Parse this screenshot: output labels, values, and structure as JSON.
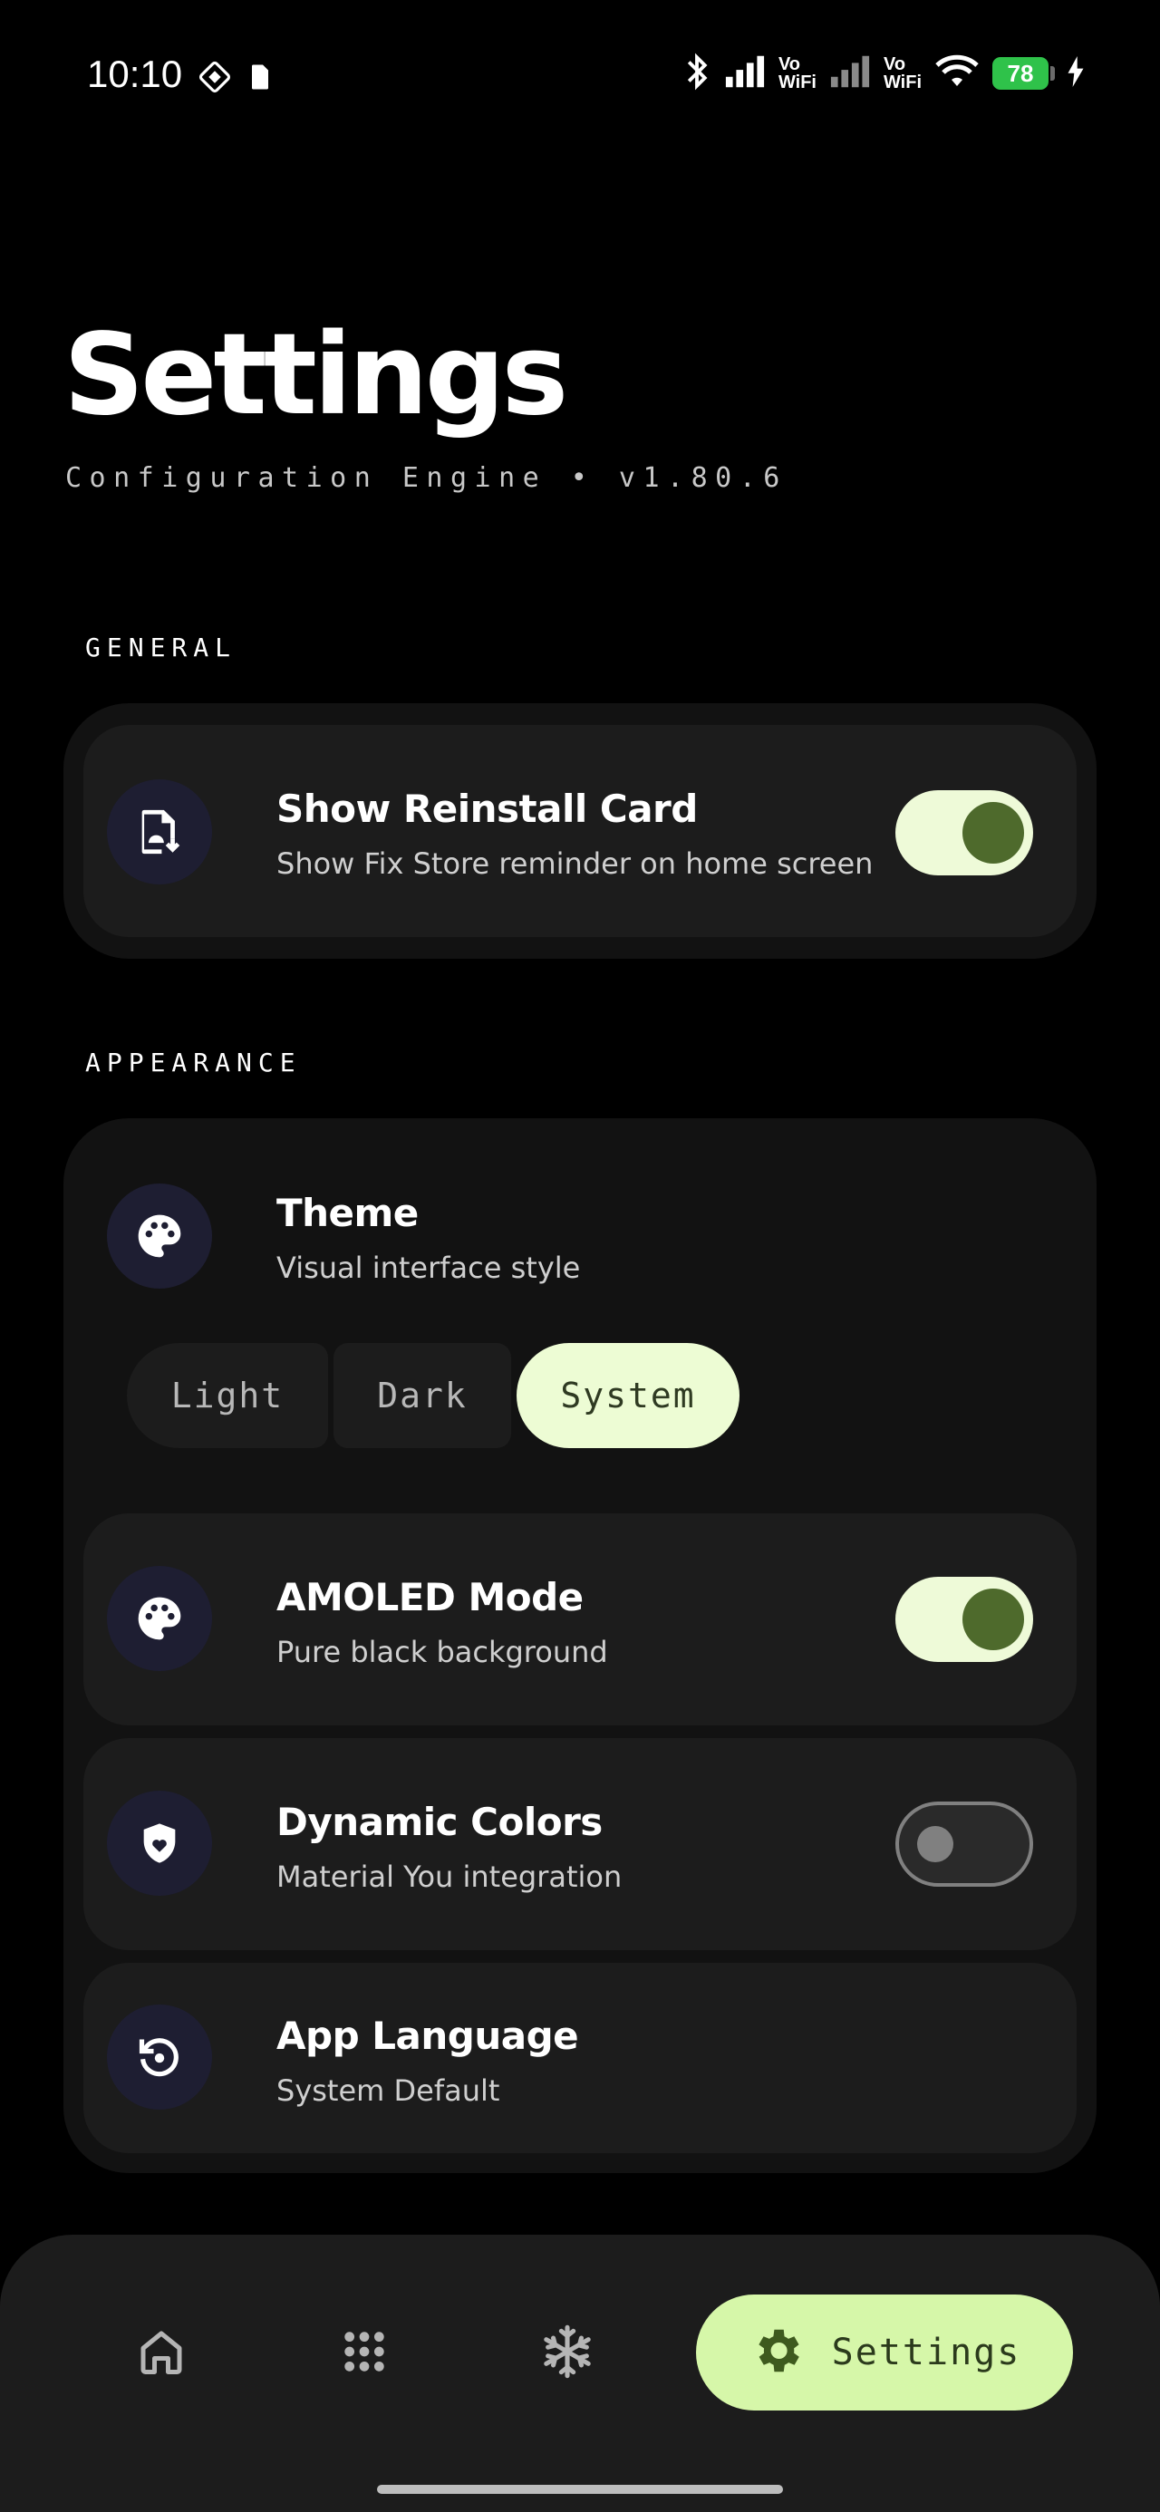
{
  "status_bar": {
    "time": "10:10",
    "vowifi_1": [
      "Vo",
      "WiFi"
    ],
    "vowifi_2": [
      "Vo",
      "WiFi"
    ],
    "battery": "78",
    "icons": [
      "gallery-icon",
      "sim-icon",
      "bluetooth-icon",
      "signal-icon",
      "wifi-icon",
      "charging-icon"
    ]
  },
  "header": {
    "title": "Settings",
    "subtitle": "Configuration Engine • v1.80.6"
  },
  "general": {
    "label": "GENERAL",
    "reinstall": {
      "title": "Show Reinstall Card",
      "subtitle": "Show Fix Store reminder on home screen",
      "enabled": true
    }
  },
  "appearance": {
    "label": "APPEARANCE",
    "theme": {
      "title": "Theme",
      "subtitle": "Visual interface style",
      "options": [
        "Light",
        "Dark",
        "System"
      ],
      "selected": "System"
    },
    "amoled": {
      "title": "AMOLED Mode",
      "subtitle": "Pure black background",
      "enabled": true
    },
    "dynamic": {
      "title": "Dynamic Colors",
      "subtitle": "Material You integration",
      "enabled": false
    },
    "language": {
      "title": "App Language",
      "subtitle": "System Default"
    }
  },
  "nav": {
    "items": [
      "home-icon",
      "apps-grid-icon",
      "snowflake-icon",
      "gear-icon"
    ],
    "active_label": "Settings"
  },
  "colors": {
    "accent": "#d6f7a9",
    "toggle_on_track": "#eefad8",
    "toggle_on_knob": "#4e6a2c",
    "card": "#1c1c1c",
    "group": "#121212"
  }
}
